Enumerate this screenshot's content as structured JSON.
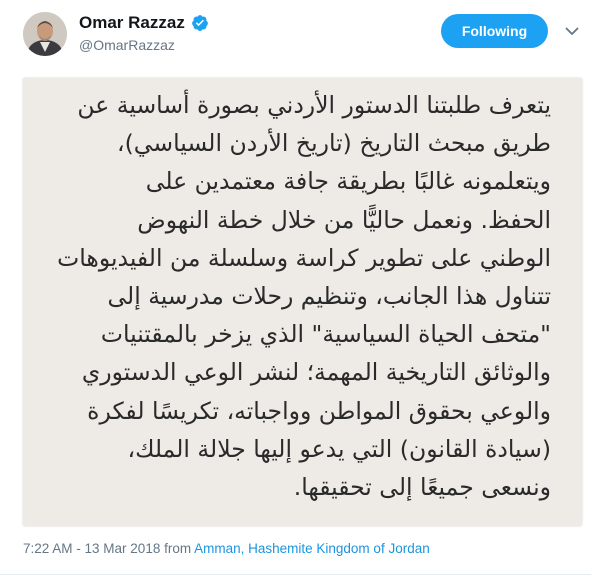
{
  "user": {
    "name": "Omar Razzaz",
    "handle": "@OmarRazzaz",
    "verified_icon": "verified-badge-icon",
    "avatar_icon": "profile-photo"
  },
  "actions": {
    "follow_label": "Following",
    "follow_color": "#1da1f2",
    "more_icon": "chevron-down-icon"
  },
  "note": {
    "lines": [
      "يتعرف طلبتنا الدستور الأردني بصورة أساسية عن",
      "طريق مبحث التاريخ (تاريخ الأردن السياسي)،",
      "ويتعلمونه غالبًا بطريقة جافة معتمدين على",
      "الحفظ. ونعمل حاليًّا من خلال خطة النهوض",
      "الوطني على تطوير كراسة وسلسلة من الفيديوهات",
      "تتناول هذا الجانب، وتنظيم رحلات مدرسية إلى",
      "\"متحف الحياة السياسية\" الذي يزخر بالمقتنيات",
      "والوثائق التاريخية المهمة؛ لنشر الوعي الدستوري",
      "والوعي بحقوق المواطن وواجباته، تكريسًا لفكرة",
      "(سيادة القانون) التي يدعو إليها جلالة الملك،",
      "ونسعى جميعًا إلى تحقيقها."
    ],
    "background": "#eeebe7"
  },
  "meta": {
    "time": "7:22 AM",
    "separator": " - ",
    "date": "13 Mar 2018",
    "from_label": " from ",
    "location": "Amman, Hashemite Kingdom of Jordan",
    "link_color": "#1b95e0"
  }
}
